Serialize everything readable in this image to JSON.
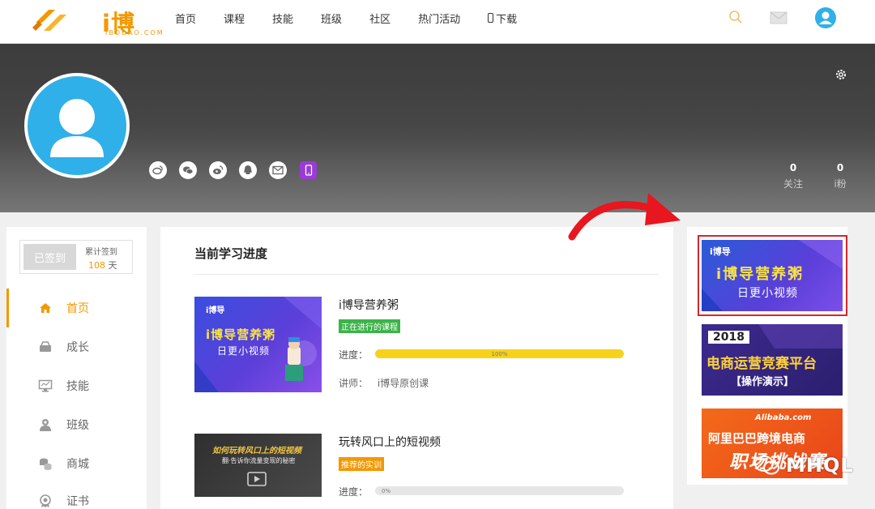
{
  "header": {
    "logo_text": "i博导",
    "logo_sub": "IBODAO.COM",
    "nav": [
      "首页",
      "课程",
      "技能",
      "班级",
      "社区",
      "热门活动",
      "下载"
    ],
    "icons": [
      "search-icon",
      "mail-icon",
      "user-avatar-icon"
    ],
    "accent_color": "#f39800"
  },
  "profile": {
    "social_icons": [
      "weibo-icon",
      "wechat-icon",
      "sina-weibo-icon",
      "qq-icon",
      "email-icon",
      "phone-icon"
    ],
    "following_count": "0",
    "following_label": "关注",
    "fans_count": "0",
    "fans_label": "i粉"
  },
  "sidebar": {
    "checkin_button": "已签到",
    "checkin_label": "累计签到",
    "checkin_days": "108",
    "checkin_unit": "天",
    "items": [
      {
        "label": "首页",
        "icon": "home-icon",
        "active": true
      },
      {
        "label": "成长",
        "icon": "growth-icon"
      },
      {
        "label": "技能",
        "icon": "monitor-icon"
      },
      {
        "label": "班级",
        "icon": "class-icon"
      },
      {
        "label": "商城",
        "icon": "coins-icon"
      },
      {
        "label": "证书",
        "icon": "certificate-icon"
      }
    ]
  },
  "main": {
    "title": "当前学习进度",
    "courses": [
      {
        "title": "i博导营养粥",
        "tag": "正在进行的课程",
        "tag_color": "#3cb34a",
        "progress_label": "进度：",
        "progress_pct": 100,
        "progress_text": "100%",
        "teacher_label": "讲师：",
        "teacher": "i博导原创课",
        "thumb_logo": "i博导",
        "thumb_line1": "i博导营养粥",
        "thumb_line2": "日更小视频"
      },
      {
        "title": "玩转风口上的短视频",
        "tag": "推荐的实训",
        "tag_color": "#f39800",
        "progress_label": "进度：",
        "progress_pct": 0,
        "progress_text": "0%",
        "thumb_logo": "i博导",
        "thumb_line1": "如何玩转风口上的短视频",
        "thumb_line2": "翻·告诉你流量变现的秘密"
      }
    ]
  },
  "ads": [
    {
      "logo": "i博导",
      "line1": "i博导营养粥",
      "line2": "日更小视频"
    },
    {
      "year": "2018",
      "line1": "电商运营竞赛平台",
      "line2": "【操作演示】"
    },
    {
      "logo": "Alibaba.com",
      "line1": "阿里巴巴跨境电商",
      "line2": "职场挑战赛"
    }
  ],
  "watermark": "MHQL"
}
